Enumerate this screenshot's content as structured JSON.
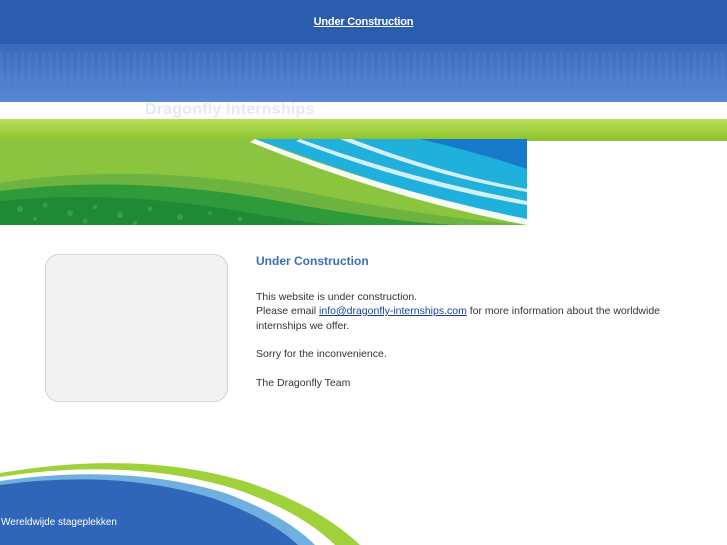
{
  "top_bar": {
    "link_label": "Under Construction"
  },
  "site": {
    "title": "Dragonfly Internships"
  },
  "main": {
    "heading": "Under Construction",
    "line1": "This website is under construction.",
    "line2_pre": "Please email ",
    "email": "info@dragonfly-internships.com",
    "line2_post": " for more information about the worldwide internships we offer.",
    "apology": "Sorry for the inconvenience.",
    "signoff": "The Dragonfly Team"
  },
  "footer": {
    "tagline": "Wereldwijde stageplekken"
  },
  "colors": {
    "top_bar": "#2a5db0",
    "header_band": "#4a7acb",
    "green_accent": "#9ccd3a",
    "heading": "#3a6fb6",
    "link": "#1a3e9e"
  }
}
